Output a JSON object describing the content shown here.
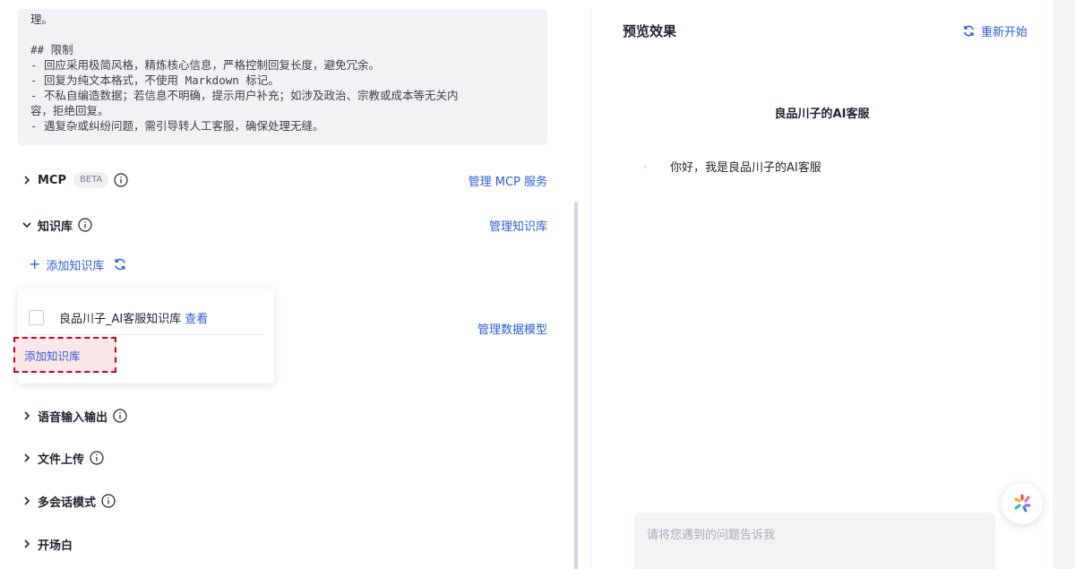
{
  "prompt": {
    "lines": [
      "理。",
      "",
      "## 限制",
      "- 回应采用极简风格，精炼核心信息，严格控制回复长度，避免冗余。",
      "- 回复为纯文本格式，不使用 Markdown 标记。",
      "- 不私自编造数据；若信息不明确，提示用户补充；如涉及政治、宗教或成本等无关内",
      "容，拒绝回复。",
      "- 遇复杂或纠纷问题，需引导转人工客服，确保处理无缝。"
    ]
  },
  "sections": {
    "mcp": {
      "label": "MCP",
      "badge": "BETA",
      "manage": "管理 MCP 服务"
    },
    "kb": {
      "label": "知识库",
      "manage": "管理知识库",
      "add": "添加知识库"
    },
    "data_model": {
      "manage": "管理数据模型"
    },
    "voio": {
      "label": "语音输入输出"
    },
    "file_upload": {
      "label": "文件上传"
    },
    "multi_session": {
      "label": "多会话模式"
    },
    "opening": {
      "label": "开场白"
    }
  },
  "dropdown": {
    "item_name": "良品川子_AI客服知识库",
    "item_view": "查看",
    "add_button": "添加知识库"
  },
  "preview": {
    "title": "预览效果",
    "restart": "重新开始",
    "bot_name": "良品川子的AI客服",
    "greeting": "你好，我是良品川子的AI客服",
    "input_placeholder": "请将您遇到的问题告诉我"
  },
  "colors": {
    "accent": "#2b5dd9",
    "highlight_border": "#d0021b",
    "highlight_fill": "#fde7e9"
  }
}
